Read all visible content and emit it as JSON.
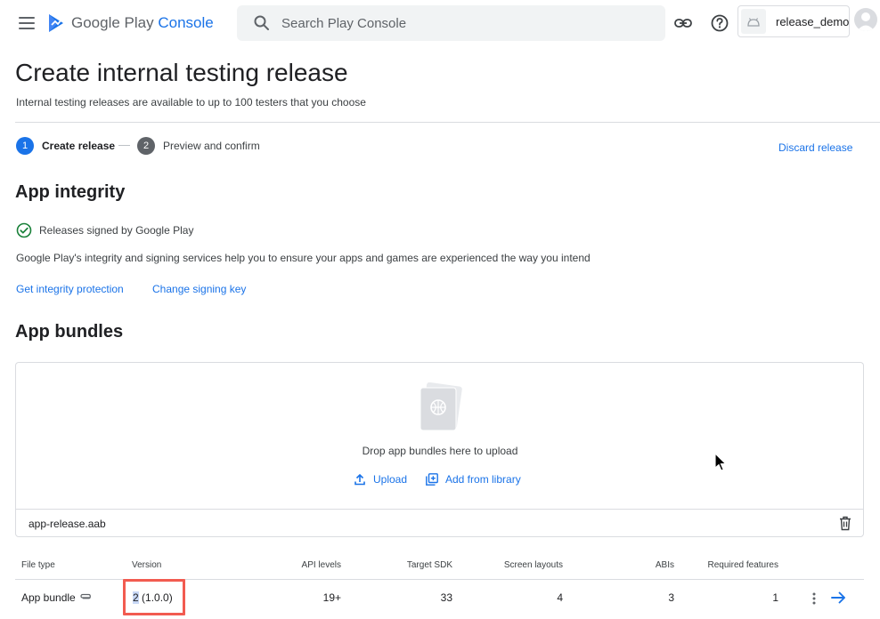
{
  "header": {
    "logo_brand": "Google Play",
    "logo_product": "Console",
    "search_placeholder": "Search Play Console",
    "app_name": "release_demo"
  },
  "page": {
    "title": "Create internal testing release",
    "subtitle": "Internal testing releases are available to up to 100 testers that you choose"
  },
  "stepper": {
    "steps": [
      {
        "number": "1",
        "label": "Create release",
        "state": "active"
      },
      {
        "number": "2",
        "label": "Preview and confirm",
        "state": "upcoming"
      }
    ],
    "discard_label": "Discard release"
  },
  "integrity": {
    "title": "App integrity",
    "signed_label": "Releases signed by Google Play",
    "description": "Google Play's integrity and signing services help you to ensure your apps and games are experienced the way you intend",
    "get_protection_label": "Get integrity protection",
    "change_key_label": "Change signing key"
  },
  "bundles": {
    "title": "App bundles",
    "drop_text": "Drop app bundles here to upload",
    "upload_label": "Upload",
    "library_label": "Add from library",
    "file_name": "app-release.aab",
    "table": {
      "columns": [
        "File type",
        "Version",
        "API levels",
        "Target SDK",
        "Screen layouts",
        "ABIs",
        "Required features"
      ],
      "rows": [
        {
          "file_type": "App bundle",
          "version_selected": "2",
          "version_rest": " (1.0.0)",
          "api_levels": "19+",
          "target_sdk": "33",
          "screen_layouts": "4",
          "abis": "3",
          "required_features": "1"
        }
      ]
    }
  },
  "colors": {
    "accent": "#1a73e8",
    "success": "#188038",
    "highlight_box": "#f25b50",
    "text_selection": "#c8d8f6"
  },
  "icons": [
    "menu-icon",
    "play-console-logo-icon",
    "search-icon",
    "link-icon",
    "help-icon",
    "android-icon",
    "avatar-icon",
    "check-circle-icon",
    "upload-icon",
    "library-add-icon",
    "delete-icon",
    "paperclip-icon",
    "more-vert-icon",
    "arrow-forward-icon"
  ]
}
